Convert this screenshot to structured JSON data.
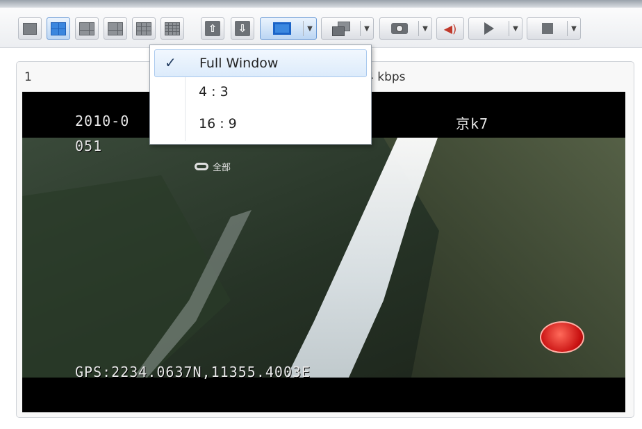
{
  "toolbar": {
    "buttons": [
      {
        "name": "layout-1-icon"
      },
      {
        "name": "layout-4-icon"
      },
      {
        "name": "layout-6-icon"
      },
      {
        "name": "layout-8-icon"
      },
      {
        "name": "layout-9-icon"
      },
      {
        "name": "layout-16-icon"
      },
      {
        "name": "previous-page-icon"
      },
      {
        "name": "next-page-icon"
      },
      {
        "name": "full-window-icon"
      },
      {
        "name": "window-mode-icon"
      },
      {
        "name": "snapshot-icon"
      },
      {
        "name": "volume-icon"
      },
      {
        "name": "play-icon"
      },
      {
        "name": "stop-icon"
      }
    ]
  },
  "panel": {
    "channel_label": "1",
    "bitrate": "4 kbps"
  },
  "video": {
    "osd_date": "2010-0",
    "osd_channel": "051",
    "osd_plate": "京k7",
    "osd_mode": "全部",
    "osd_gps": "GPS:2234.0637N,11355.4003E"
  },
  "dropdown": {
    "items": [
      {
        "label": "Full Window",
        "checked": true
      },
      {
        "label": "4 : 3",
        "checked": false
      },
      {
        "label": "16 : 9",
        "checked": false
      }
    ],
    "check_mark": "✓"
  },
  "colors": {
    "accent": "#3a86de",
    "selection": "#dcebfb"
  }
}
